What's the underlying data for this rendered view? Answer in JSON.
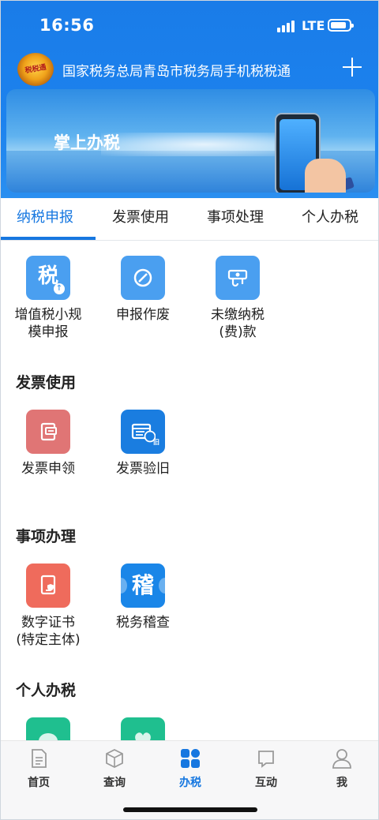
{
  "status_bar": {
    "time": "16:56",
    "network": "LTE"
  },
  "app_bar": {
    "logo_text": "税税通",
    "title": "国家税务总局青岛市税务局手机税税通"
  },
  "banner": {
    "text": "掌上办税"
  },
  "tabs": [
    {
      "label": "纳税申报",
      "active": true
    },
    {
      "label": "发票使用",
      "active": false
    },
    {
      "label": "事项处理",
      "active": false
    },
    {
      "label": "个人办税",
      "active": false
    }
  ],
  "sections": {
    "declaration": {
      "items": [
        {
          "label": "增值税小规\n模申报",
          "icon": "tax-upload-icon",
          "color": "#4a9ff0",
          "glyph": "税"
        },
        {
          "label": "申报作废",
          "icon": "cancel-icon",
          "color": "#4a9ff0"
        },
        {
          "label": "未缴纳税\n(费)款",
          "icon": "unpaid-tax-icon",
          "color": "#4a9ff0"
        }
      ]
    },
    "invoice": {
      "title": "发票使用",
      "items": [
        {
          "label": "发票申领",
          "icon": "invoice-apply-icon",
          "color": "#e07575"
        },
        {
          "label": "发票验旧",
          "icon": "invoice-verify-icon",
          "color": "#1a7de0",
          "glyph": "旧"
        }
      ]
    },
    "matters": {
      "title": "事项办理",
      "items": [
        {
          "label": "数字证书\n(特定主体)",
          "icon": "certificate-icon",
          "color": "#ef6b5c"
        },
        {
          "label": "税务稽查",
          "icon": "audit-icon",
          "color": "#1a86e8",
          "glyph": "稽"
        }
      ]
    },
    "personal": {
      "title": "个人办税",
      "items": [
        {
          "icon": "personal-tax-icon-1",
          "color": "#1fbf8f"
        },
        {
          "icon": "personal-tax-icon-2",
          "color": "#1fbf8f"
        }
      ]
    }
  },
  "bottom_nav": [
    {
      "label": "首页",
      "icon": "document-icon",
      "active": false
    },
    {
      "label": "查询",
      "icon": "cube-icon",
      "active": false
    },
    {
      "label": "办税",
      "icon": "grid-icon",
      "active": true
    },
    {
      "label": "互动",
      "icon": "chat-icon",
      "active": false
    },
    {
      "label": "我",
      "icon": "user-icon",
      "active": false
    }
  ],
  "colors": {
    "primary": "#1677e0",
    "header": "#1c82ee"
  }
}
